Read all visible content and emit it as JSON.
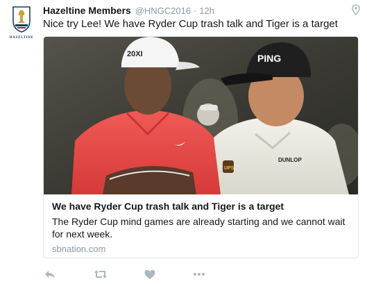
{
  "author": {
    "name": "Hazeltine Members",
    "handle": "@HNGC2016",
    "separator": "·",
    "time": "12h",
    "avatar_text": "HAZELTINE",
    "avatar_icon": "ryder-cup-crest-icon"
  },
  "tweet": {
    "text": "Nice try Lee! We have Ryder Cup trash talk and Tiger is a target"
  },
  "card": {
    "title": "We have Ryder Cup trash talk and Tiger is a target",
    "description": "The Ryder Cup mind games are already starting and we cannot wait for next week.",
    "domain": "sbnation.com",
    "image_text": {
      "cap_left": "20XI",
      "cap_right": "PING",
      "shirt_right": "DUNLOP",
      "badge_right": "UPS"
    }
  },
  "actions": {
    "reply_icon": "reply-icon",
    "retweet_icon": "retweet-icon",
    "like_icon": "heart-icon",
    "more_icon": "more-icon"
  },
  "colors": {
    "action_gray": "#aab8c2",
    "text_muted": "#8899a6",
    "border": "#e1e8ed"
  }
}
